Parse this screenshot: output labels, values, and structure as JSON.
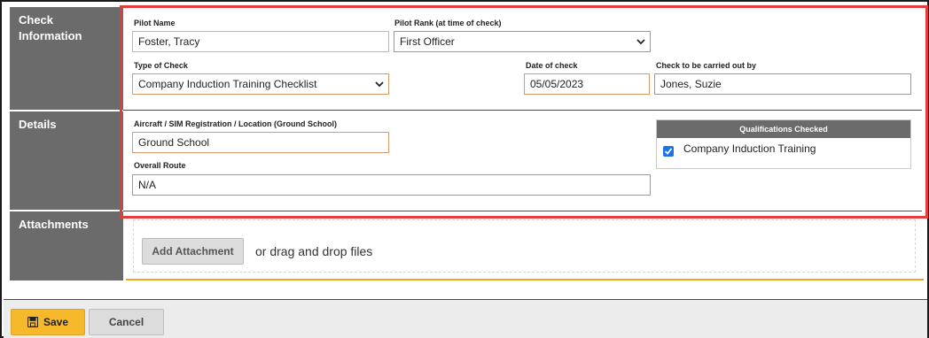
{
  "sections": {
    "check_information": "Check\nInformation",
    "details": "Details",
    "attachments": "Attachments"
  },
  "fields": {
    "pilot_name": {
      "label": "Pilot Name",
      "value": "Foster, Tracy"
    },
    "pilot_rank": {
      "label": "Pilot Rank (at time of check)",
      "value": "First Officer"
    },
    "type_of_check": {
      "label": "Type of Check",
      "value": "Company Induction Training Checklist"
    },
    "date_of_check": {
      "label": "Date of check",
      "value": "05/05/2023"
    },
    "check_by": {
      "label": "Check to be carried out by",
      "value": "Jones, Suzie"
    },
    "aircraft": {
      "label": "Aircraft / SIM Registration / Location (Ground School)",
      "value": "Ground School"
    },
    "route": {
      "label": "Overall Route",
      "value": "N/A"
    }
  },
  "qualifications": {
    "header": "Qualifications Checked",
    "items": [
      {
        "label": "Company Induction Training",
        "checked": true
      }
    ]
  },
  "attachments": {
    "button_label": "Add Attachment",
    "drag_text": "or drag and drop files"
  },
  "footer": {
    "save_label": "Save",
    "cancel_label": "Cancel"
  },
  "colors": {
    "highlight": "#e53b3b",
    "save_button": "#f6b92b",
    "section_bg": "#6b6b6b",
    "accent_line": "#f2a516",
    "checkbox": "#1a73e8"
  },
  "icons": {
    "select_chevron": "chevron-down-icon",
    "save": "floppy-disk-icon",
    "checkbox": "checkmark-icon"
  }
}
